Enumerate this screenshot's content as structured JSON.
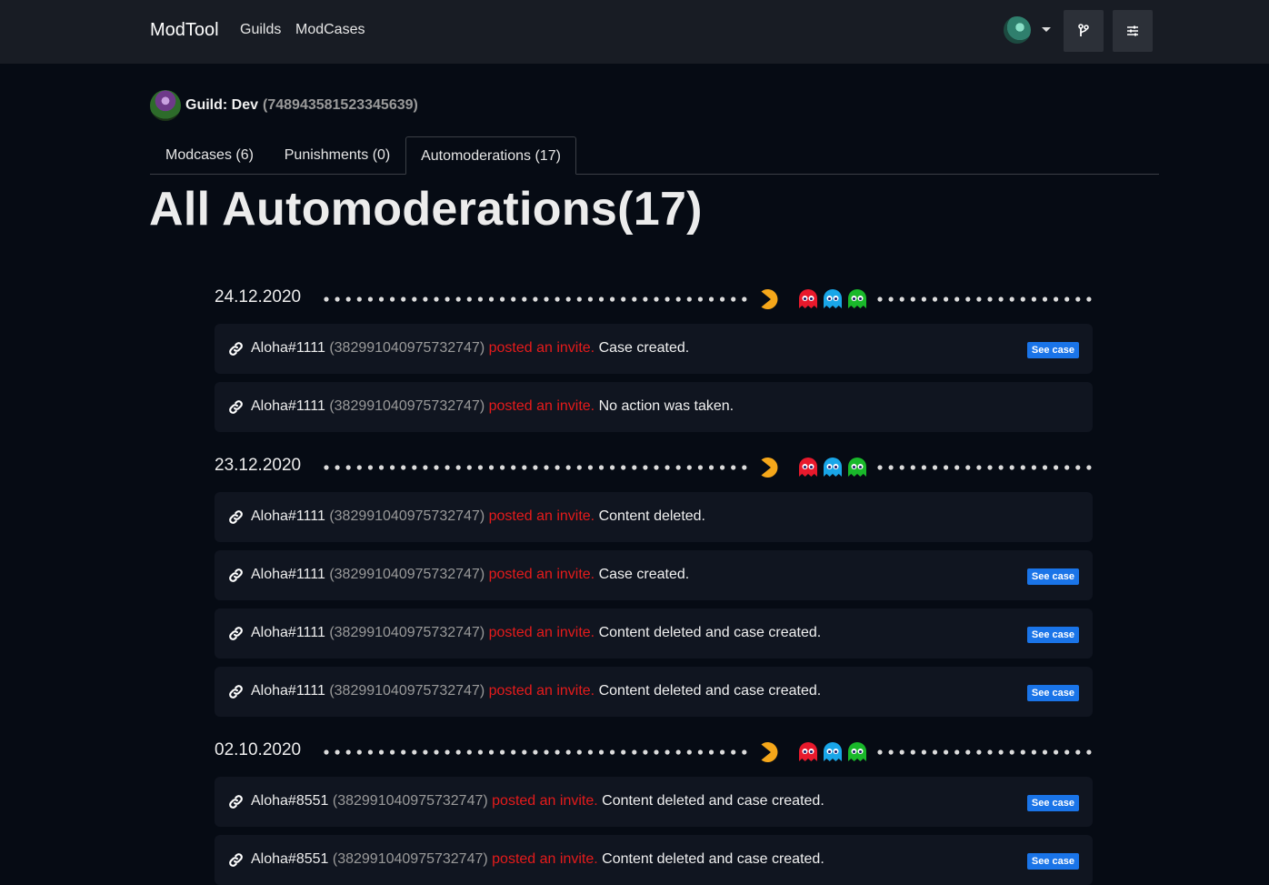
{
  "navbar": {
    "brand": "ModTool",
    "links": [
      "Guilds",
      "ModCases"
    ]
  },
  "guild": {
    "label": "Guild: Dev",
    "id": "(748943581523345639)"
  },
  "tabs": [
    {
      "label": "Modcases (6)",
      "active": false
    },
    {
      "label": "Punishments (0)",
      "active": false
    },
    {
      "label": "Automoderations (17)",
      "active": true
    }
  ],
  "page_title": "All Automoderations(17)",
  "see_case_label": "See case",
  "colors": {
    "accent": "#1a74e8",
    "action_red": "#e51b1b",
    "background": "#060b14",
    "card": "#101520",
    "ghost_red": "#e8192c",
    "ghost_blue": "#19a6e8",
    "ghost_green": "#19b82a",
    "pacman": "#f5a71a"
  },
  "groups": [
    {
      "date": "24.12.2020",
      "entries": [
        {
          "user": "Aloha#1111",
          "uid": "(382991040975732747)",
          "action": "posted an invite.",
          "result": "Case created.",
          "has_case": true
        },
        {
          "user": "Aloha#1111",
          "uid": "(382991040975732747)",
          "action": "posted an invite.",
          "result": "No action was taken.",
          "has_case": false
        }
      ]
    },
    {
      "date": "23.12.2020",
      "entries": [
        {
          "user": "Aloha#1111",
          "uid": "(382991040975732747)",
          "action": "posted an invite.",
          "result": "Content deleted.",
          "has_case": false
        },
        {
          "user": "Aloha#1111",
          "uid": "(382991040975732747)",
          "action": "posted an invite.",
          "result": "Case created.",
          "has_case": true
        },
        {
          "user": "Aloha#1111",
          "uid": "(382991040975732747)",
          "action": "posted an invite.",
          "result": "Content deleted and case created.",
          "has_case": true
        },
        {
          "user": "Aloha#1111",
          "uid": "(382991040975732747)",
          "action": "posted an invite.",
          "result": "Content deleted and case created.",
          "has_case": true
        }
      ]
    },
    {
      "date": "02.10.2020",
      "entries": [
        {
          "user": "Aloha#8551",
          "uid": "(382991040975732747)",
          "action": "posted an invite.",
          "result": "Content deleted and case created.",
          "has_case": true
        },
        {
          "user": "Aloha#8551",
          "uid": "(382991040975732747)",
          "action": "posted an invite.",
          "result": "Content deleted and case created.",
          "has_case": true
        }
      ]
    }
  ]
}
